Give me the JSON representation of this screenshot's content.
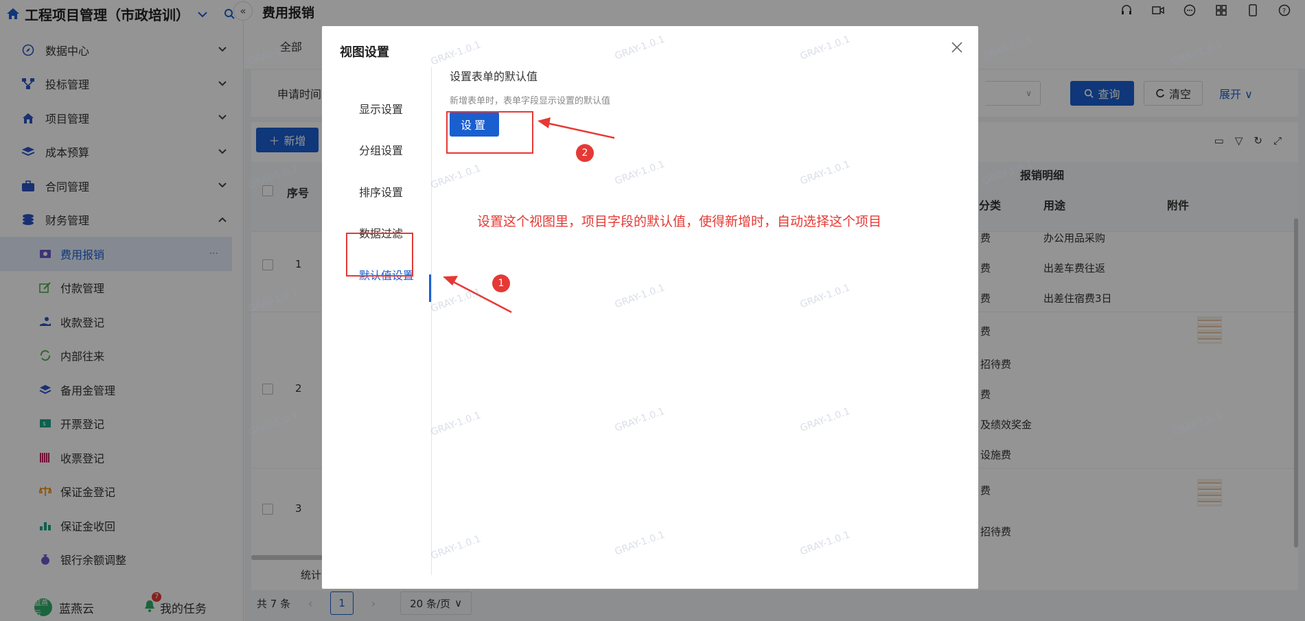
{
  "app": {
    "title": "工程项目管理（市政培训）"
  },
  "sidebar": {
    "menus": [
      {
        "label": "数据中心",
        "icon": "compass-icon"
      },
      {
        "label": "投标管理",
        "icon": "network-icon"
      },
      {
        "label": "项目管理",
        "icon": "house-icon"
      },
      {
        "label": "成本预算",
        "icon": "stack-icon"
      },
      {
        "label": "合同管理",
        "icon": "briefcase-icon"
      },
      {
        "label": "财务管理",
        "icon": "coins-icon"
      }
    ],
    "sub_items": [
      {
        "label": "费用报销",
        "icon": "money-icon"
      },
      {
        "label": "付款管理",
        "icon": "edit-icon"
      },
      {
        "label": "收款登记",
        "icon": "hand-coin-icon"
      },
      {
        "label": "内部往来",
        "icon": "refresh-icon"
      },
      {
        "label": "备用金管理",
        "icon": "layers-icon"
      },
      {
        "label": "开票登记",
        "icon": "invoice-icon"
      },
      {
        "label": "收票登记",
        "icon": "barcode-icon"
      },
      {
        "label": "保证金登记",
        "icon": "scale-icon"
      },
      {
        "label": "保证金收回",
        "icon": "bars-icon"
      },
      {
        "label": "银行余额调整",
        "icon": "money-bag-icon"
      }
    ],
    "user": {
      "name": "蓝燕云",
      "avatar_text": "蓝燕云"
    },
    "tasks": {
      "label": "我的任务",
      "badge": "7"
    }
  },
  "main": {
    "title": "费用报销",
    "tab": "全部",
    "filter_label": "申请时间",
    "query_label": "查询",
    "clear_label": "清空",
    "expand_label": "展开",
    "add_label": "新增",
    "headers": {
      "seq": "序号",
      "group": "报销明细",
      "category": "分类",
      "usage": "用途",
      "attachment": "附件"
    },
    "rows": [
      {
        "num": "1",
        "cats": [
          "费",
          "费",
          "费"
        ],
        "uses": [
          "办公用品采购",
          "出差车费往返",
          "出差住宿费3日"
        ]
      },
      {
        "num": "2",
        "cats": [
          "费",
          "招待费",
          "费",
          "及绩效奖金",
          "设施费"
        ],
        "uses": []
      },
      {
        "num": "3",
        "cats": [
          "费",
          "招待费"
        ],
        "uses": []
      }
    ],
    "stat_label": "统计",
    "pager": {
      "total": "共 7 条",
      "page": "1",
      "size": "20 条/页"
    }
  },
  "modal": {
    "title": "视图设置",
    "nav": [
      "显示设置",
      "分组设置",
      "排序设置",
      "数据过滤",
      "默认值设置"
    ],
    "section_title": "设置表单的默认值",
    "section_desc": "新增表单时，表单字段显示设置的默认值",
    "set_button": "设置",
    "annotation": "设置这个视图里，项目字段的默认值，使得新增时，自动选择这个项目",
    "marker1": "1",
    "marker2": "2"
  },
  "watermark": "GRAY-1.0.1",
  "colors": {
    "primary": "#1a5fd0",
    "annotation_red": "#e53935"
  }
}
